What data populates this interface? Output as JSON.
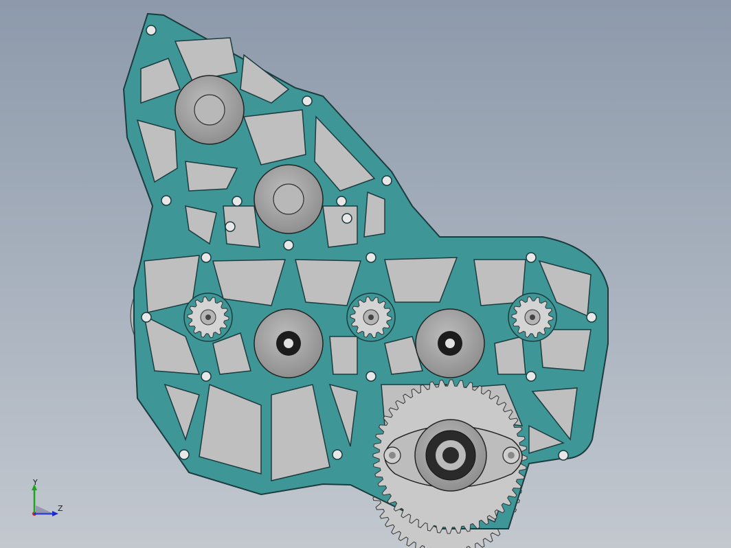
{
  "viewport": {
    "background_top": "#8d9aab",
    "background_bottom": "#c3c8cf"
  },
  "model": {
    "plate_color": "#3e9696",
    "plate_edge_color": "#1b3b3e",
    "gear_color": "#c9c9c9",
    "hub_color": "#a7a7a7",
    "bearing_color": "#1c1c1c"
  },
  "triad": {
    "y_label": "Y",
    "z_label": "Z",
    "y_color": "#1aa51a",
    "z_color": "#1a2ad0",
    "x_color": "#d01a1a"
  }
}
